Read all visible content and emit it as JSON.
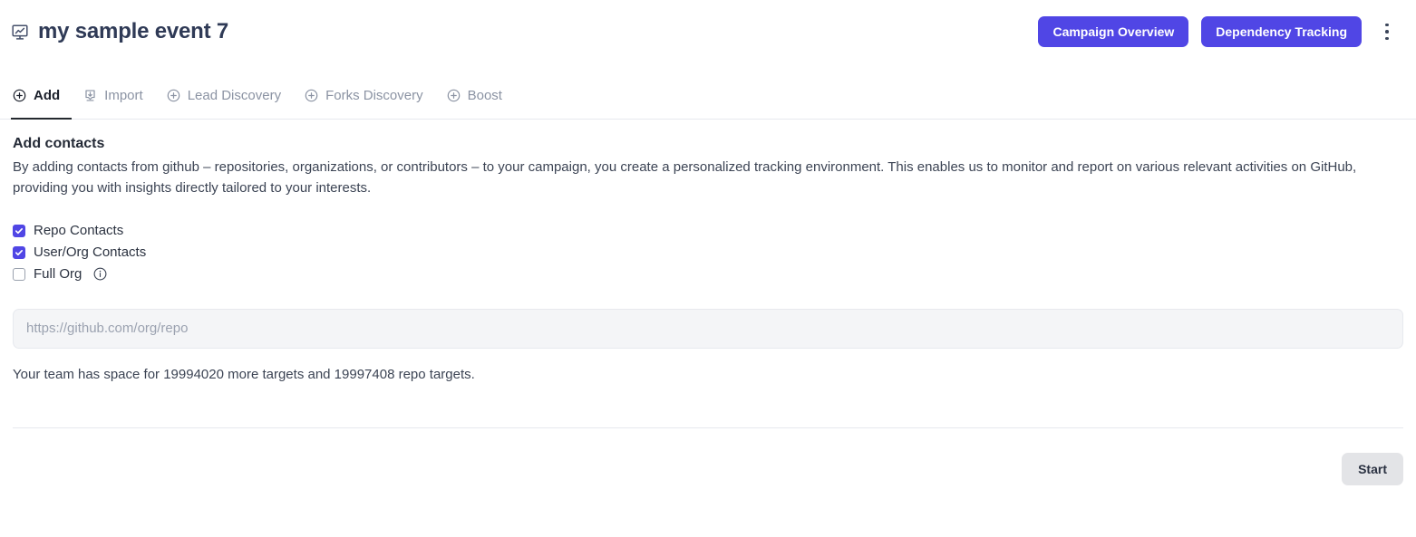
{
  "header": {
    "icon": "presentation-chart-icon",
    "title": "my sample event 7",
    "actions": {
      "campaign_overview_label": "Campaign Overview",
      "dependency_tracking_label": "Dependency Tracking",
      "menu_icon": "kebab-menu-icon"
    },
    "accent_color": "#5046e5"
  },
  "tabs": [
    {
      "label": "Add",
      "icon": "plus-circle-icon",
      "active": true
    },
    {
      "label": "Import",
      "icon": "import-tray-icon",
      "active": false
    },
    {
      "label": "Lead Discovery",
      "icon": "plus-circle-icon",
      "active": false
    },
    {
      "label": "Forks Discovery",
      "icon": "plus-circle-icon",
      "active": false
    },
    {
      "label": "Boost",
      "icon": "plus-circle-icon",
      "active": false
    }
  ],
  "main": {
    "heading": "Add contacts",
    "description": "By adding contacts from github – repositories, organizations, or contributors – to your campaign, you create a personalized tracking environment. This enables us to monitor and report on various relevant activities on GitHub, providing you with insights directly tailored to your interests.",
    "checkboxes": [
      {
        "label": "Repo Contacts",
        "checked": true,
        "info": false
      },
      {
        "label": "User/Org Contacts",
        "checked": true,
        "info": false
      },
      {
        "label": "Full Org",
        "checked": false,
        "info": true,
        "info_icon": "info-circle-icon"
      }
    ],
    "url_field": {
      "placeholder": "https://github.com/org/repo",
      "value": ""
    },
    "quota_note": "Your team has space for 19994020 more targets and 19997408 repo targets."
  },
  "footer": {
    "start_label": "Start"
  }
}
